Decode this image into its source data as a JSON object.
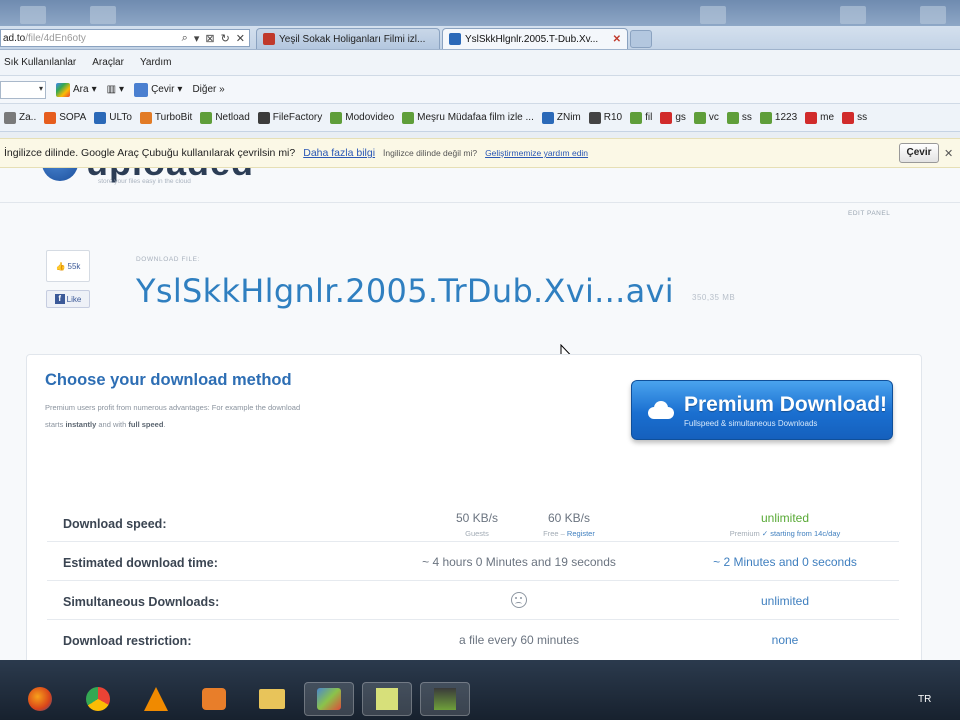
{
  "browser": {
    "address_url": "ad.to",
    "address_url_gray": "/file/4dEn6oty",
    "address_buttons": [
      "⌕",
      "▾",
      "⊠",
      "↻",
      "✕"
    ],
    "tabs": [
      {
        "label": "Yeşil Sokak Holiganları Filmi izl...",
        "active": false
      },
      {
        "label": "YslSkkHlgnlr.2005.T-Dub.Xv...",
        "active": true,
        "close": "✕"
      }
    ]
  },
  "menu": {
    "items": [
      "Sık Kullanılanlar",
      "Araçlar",
      "Yardım"
    ]
  },
  "google_toolbar": {
    "search_dropdown": "▾",
    "ara": "Ara",
    "ara_dd": "▾",
    "grid_dd": "▾",
    "cevir": "Çevir",
    "cevir_dd": "▾",
    "diger": "Diğer »"
  },
  "bookmarks": [
    {
      "label": "Za..",
      "color": "#7a7a7a"
    },
    {
      "label": "SOPA",
      "color": "#e65d1e"
    },
    {
      "label": "ULTo",
      "color": "#2b69b8"
    },
    {
      "label": "TurboBit",
      "color": "#e27b26"
    },
    {
      "label": "Netload",
      "color": "#5f9e3a"
    },
    {
      "label": "FileFactory",
      "color": "#3c3c3c"
    },
    {
      "label": "Modovideo",
      "color": "#5f9e3a"
    },
    {
      "label": "Meşru Müdafaa film izle ...",
      "color": "#5f9e3a"
    },
    {
      "label": "ZNim",
      "color": "#2b69b8"
    },
    {
      "label": "R10",
      "color": "#444"
    },
    {
      "label": "fil",
      "color": "#5f9e3a"
    },
    {
      "label": "gs",
      "color": "#d12b2b"
    },
    {
      "label": "vc",
      "color": "#5f9e3a"
    },
    {
      "label": "ss",
      "color": "#5f9e3a"
    },
    {
      "label": "1223",
      "color": "#5f9e3a"
    },
    {
      "label": "me",
      "color": "#d12b2b"
    },
    {
      "label": "ss",
      "color": "#d12b2b"
    }
  ],
  "translate_bar": {
    "message": "İngilizce dilinde. Google Araç Çubuğu kullanılarak çevrilsin mi?",
    "more_link": "Daha fazla bilgi",
    "not_language": "İngilizce dilinde değil mi?",
    "report_link": "Geliştirmemize yardım edin",
    "button": "Çevir",
    "close": "✕"
  },
  "page": {
    "logo_text": "uploaded",
    "logo_tagline": "store your files easy in the cloud",
    "edit_panel": "EDIT PANEL",
    "like_count": "55k",
    "fb_like": "Like",
    "download_file_label": "DOWNLOAD FILE:",
    "file_name": "YslSkkHlgnlr.2005.TrDub.Xvi...avi",
    "file_size": "350,35 MB",
    "choose_title": "Choose your download method",
    "desc_1": "Premium users profit from numerous advantages: For example the download starts",
    "desc_bold_1": "instantly",
    "desc_2": "and with",
    "desc_bold_2": "full speed",
    "desc_3": ".",
    "premium_title": "Premium Download!",
    "premium_sub": "Fullspeed & simultaneous Downloads"
  },
  "table": {
    "rows": [
      {
        "label": "Download speed:",
        "guest_value": "50 KB/s",
        "guest_sub": "Guests",
        "free_value": "60 KB/s",
        "free_sub": "Free –",
        "free_link": "Register",
        "premium_value": "unlimited",
        "premium_sub": "Premium",
        "premium_link": "✓ starting from 14c/day"
      },
      {
        "label": "Estimated download time:",
        "free_value": "~ 4 hours 0 Minutes and 19 seconds",
        "premium_value": "~ 2 Minutes and 0 seconds"
      },
      {
        "label": "Simultaneous Downloads:",
        "free_icon": "sad-face-icon",
        "premium_value": "unlimited"
      },
      {
        "label": "Download restriction:",
        "free_value": "a file every 60 minutes",
        "premium_value": "none"
      }
    ]
  },
  "taskbar": {
    "apps": [
      "firefox",
      "chrome",
      "vlc",
      "media-player",
      "explorer",
      "app",
      "notes",
      "app2"
    ],
    "lang": "TR"
  },
  "colors": {
    "accent_blue": "#2f7fc0",
    "premium_button": "#1a6fd0",
    "green": "#58a935"
  }
}
